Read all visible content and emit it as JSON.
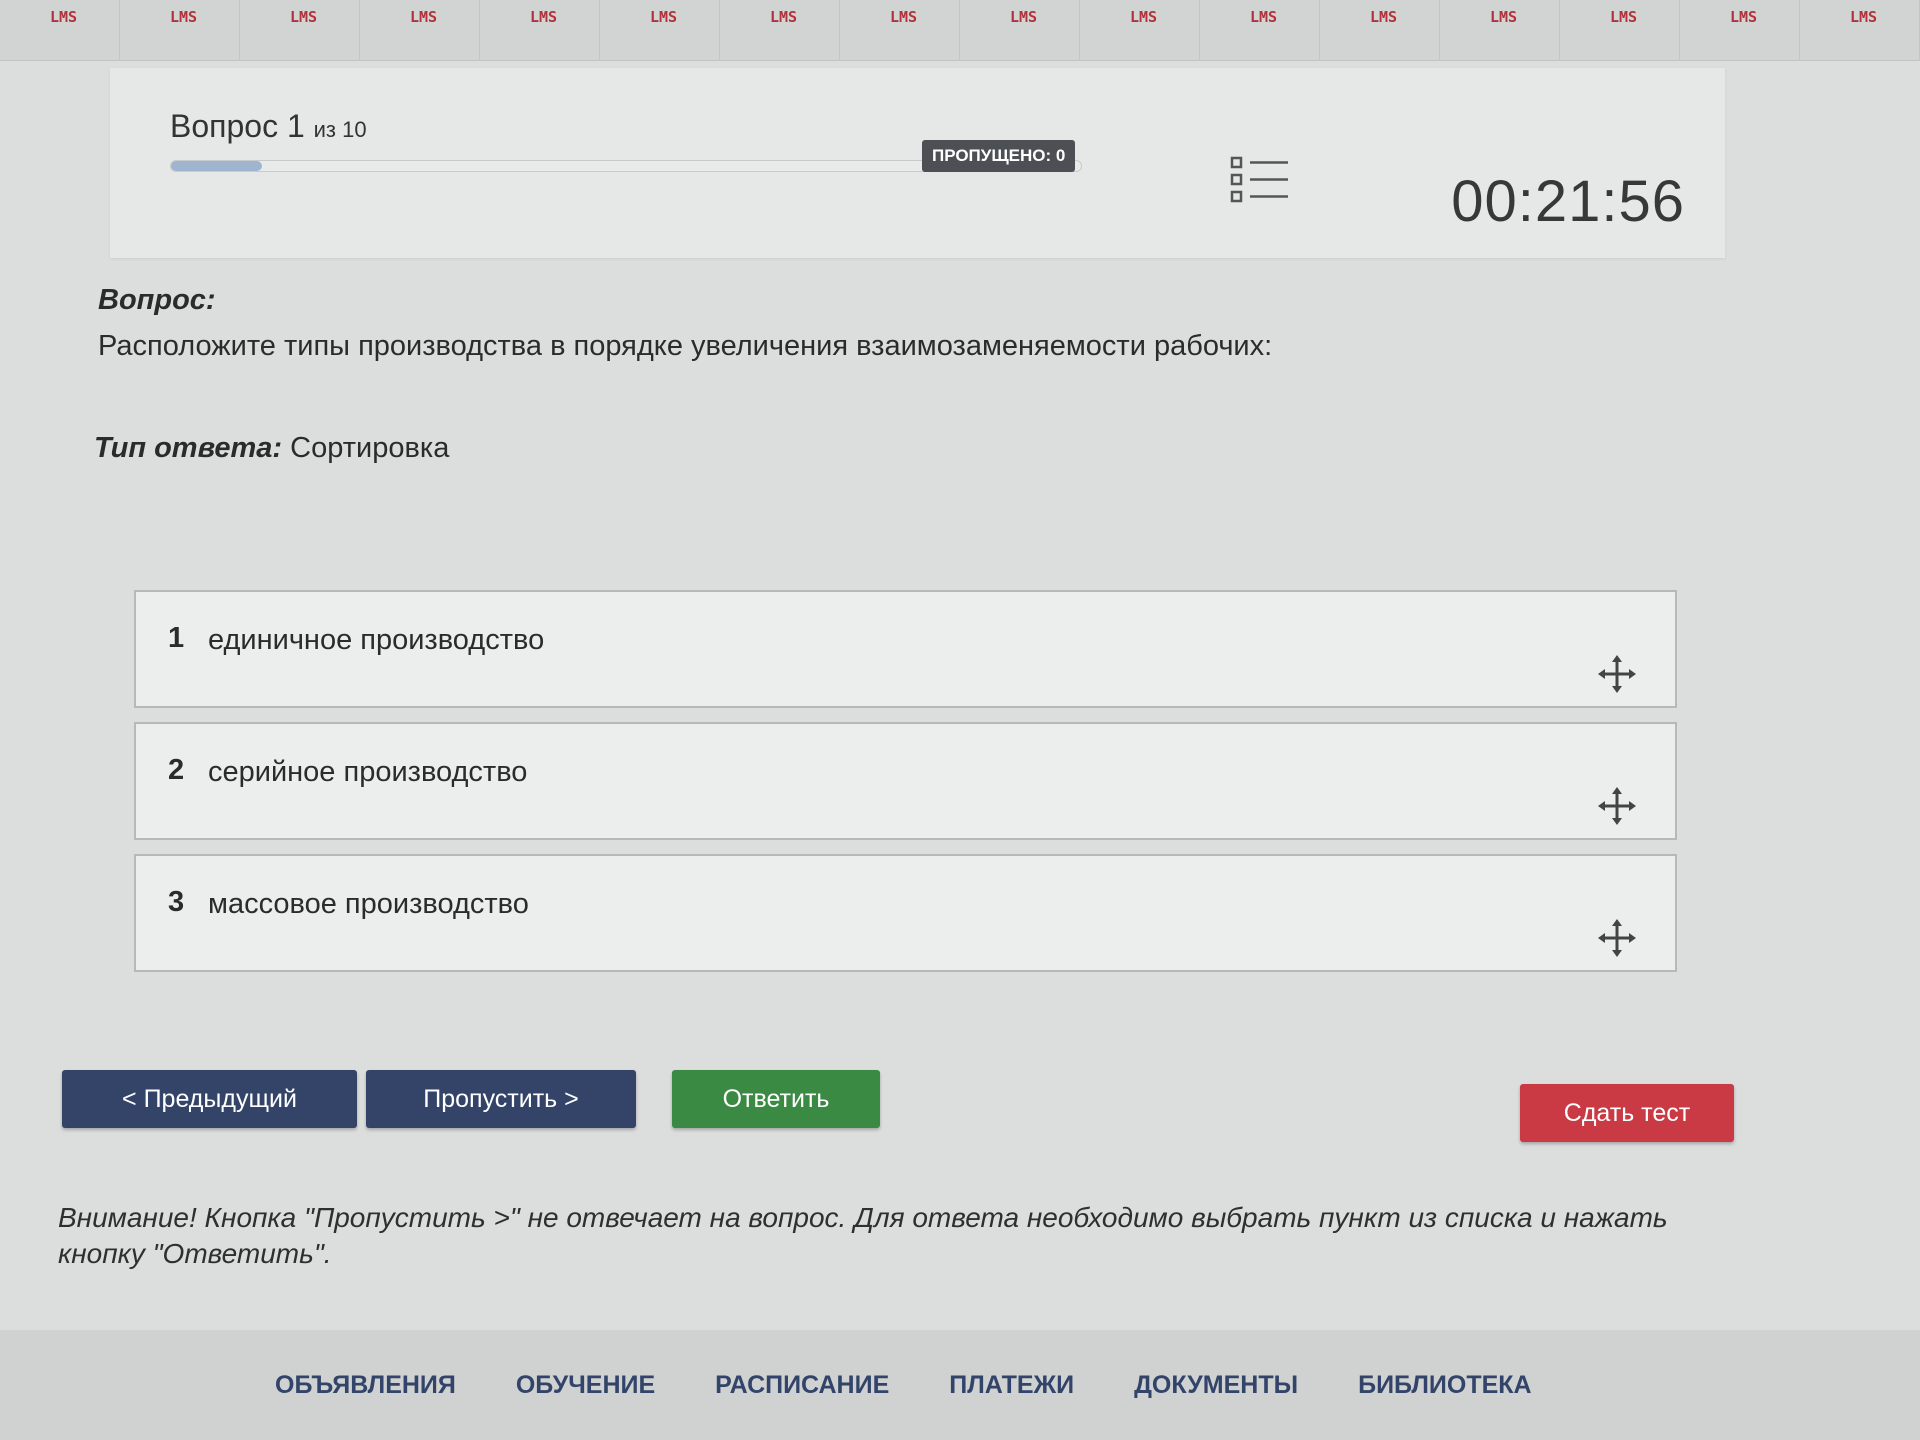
{
  "tabs": [
    "LMS",
    "LMS",
    "LMS",
    "LMS",
    "LMS",
    "LMS",
    "LMS",
    "LMS",
    "LMS",
    "LMS",
    "LMS",
    "LMS",
    "LMS",
    "LMS",
    "LMS",
    "LMS"
  ],
  "header": {
    "question_label": "Вопрос 1",
    "question_of": "из 10",
    "progress_fraction": 0.1,
    "skipped_badge": "ПРОПУЩЕНО: 0",
    "timer": "00:21:56"
  },
  "question": {
    "label": "Вопрос:",
    "text": "Расположите типы производства в порядке увеличения взаимозаменяемости рабочих:",
    "answer_type_label": "Тип ответа:",
    "answer_type_value": "Сортировка"
  },
  "sort_items": [
    {
      "num": "1",
      "text": "единичное производство"
    },
    {
      "num": "2",
      "text": "серийное производство"
    },
    {
      "num": "3",
      "text": "массовое производство"
    }
  ],
  "buttons": {
    "prev": "< Предыдущий",
    "skip": "Пропустить >",
    "answer": "Ответить",
    "submit": "Сдать тест"
  },
  "warning": "Внимание! Кнопка \"Пропустить >\" не отвечает на вопрос. Для ответа необходимо выбрать пункт из списка и нажать кнопку \"Ответить\".",
  "nav": [
    "ОБЪЯВЛЕНИЯ",
    "ОБУЧЕНИЕ",
    "РАСПИСАНИЕ",
    "ПЛАТЕЖИ",
    "ДОКУМЕНТЫ",
    "БИБЛИОТЕКА"
  ],
  "colors": {
    "primary_button": "#344468",
    "answer_button": "#3b8a44",
    "submit_button": "#c93a44",
    "tab_text": "#b0323a"
  }
}
